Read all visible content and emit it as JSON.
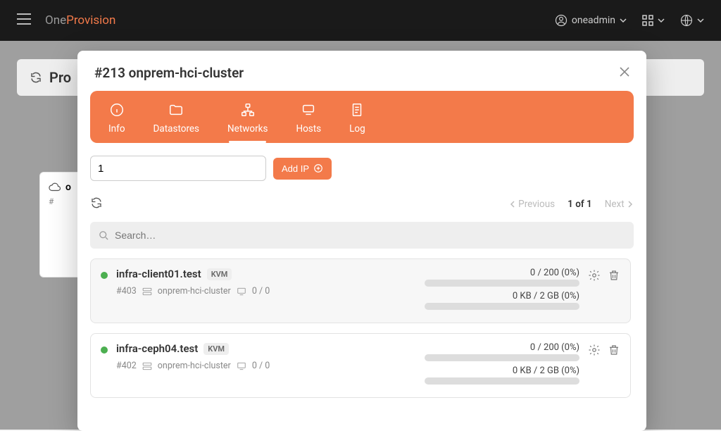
{
  "topbar": {
    "brand_one": "One",
    "brand_provision": "Provision",
    "user": "oneadmin"
  },
  "background": {
    "title_prefix": "Pro",
    "card_name": "o",
    "card_id": "#"
  },
  "modal": {
    "title": "#213 onprem-hci-cluster",
    "tabs": {
      "info": "Info",
      "datastores": "Datastores",
      "networks": "Networks",
      "hosts": "Hosts",
      "log": "Log"
    },
    "active_tab": "Networks",
    "ip_count_value": "1",
    "add_ip_label": "Add IP",
    "pager": {
      "previous": "Previous",
      "status": "1 of 1",
      "next": "Next"
    },
    "search_placeholder": "Search…"
  },
  "hosts": [
    {
      "name": "infra-client01.test",
      "hv": "KVM",
      "id": "#403",
      "cluster": "onprem-hci-cluster",
      "vms": "0 / 0",
      "cpu": "0 / 200 (0%)",
      "mem": "0 KB / 2 GB (0%)",
      "selected": true
    },
    {
      "name": "infra-ceph04.test",
      "hv": "KVM",
      "id": "#402",
      "cluster": "onprem-hci-cluster",
      "vms": "0 / 0",
      "cpu": "0 / 200 (0%)",
      "mem": "0 KB / 2 GB (0%)",
      "selected": false
    }
  ]
}
